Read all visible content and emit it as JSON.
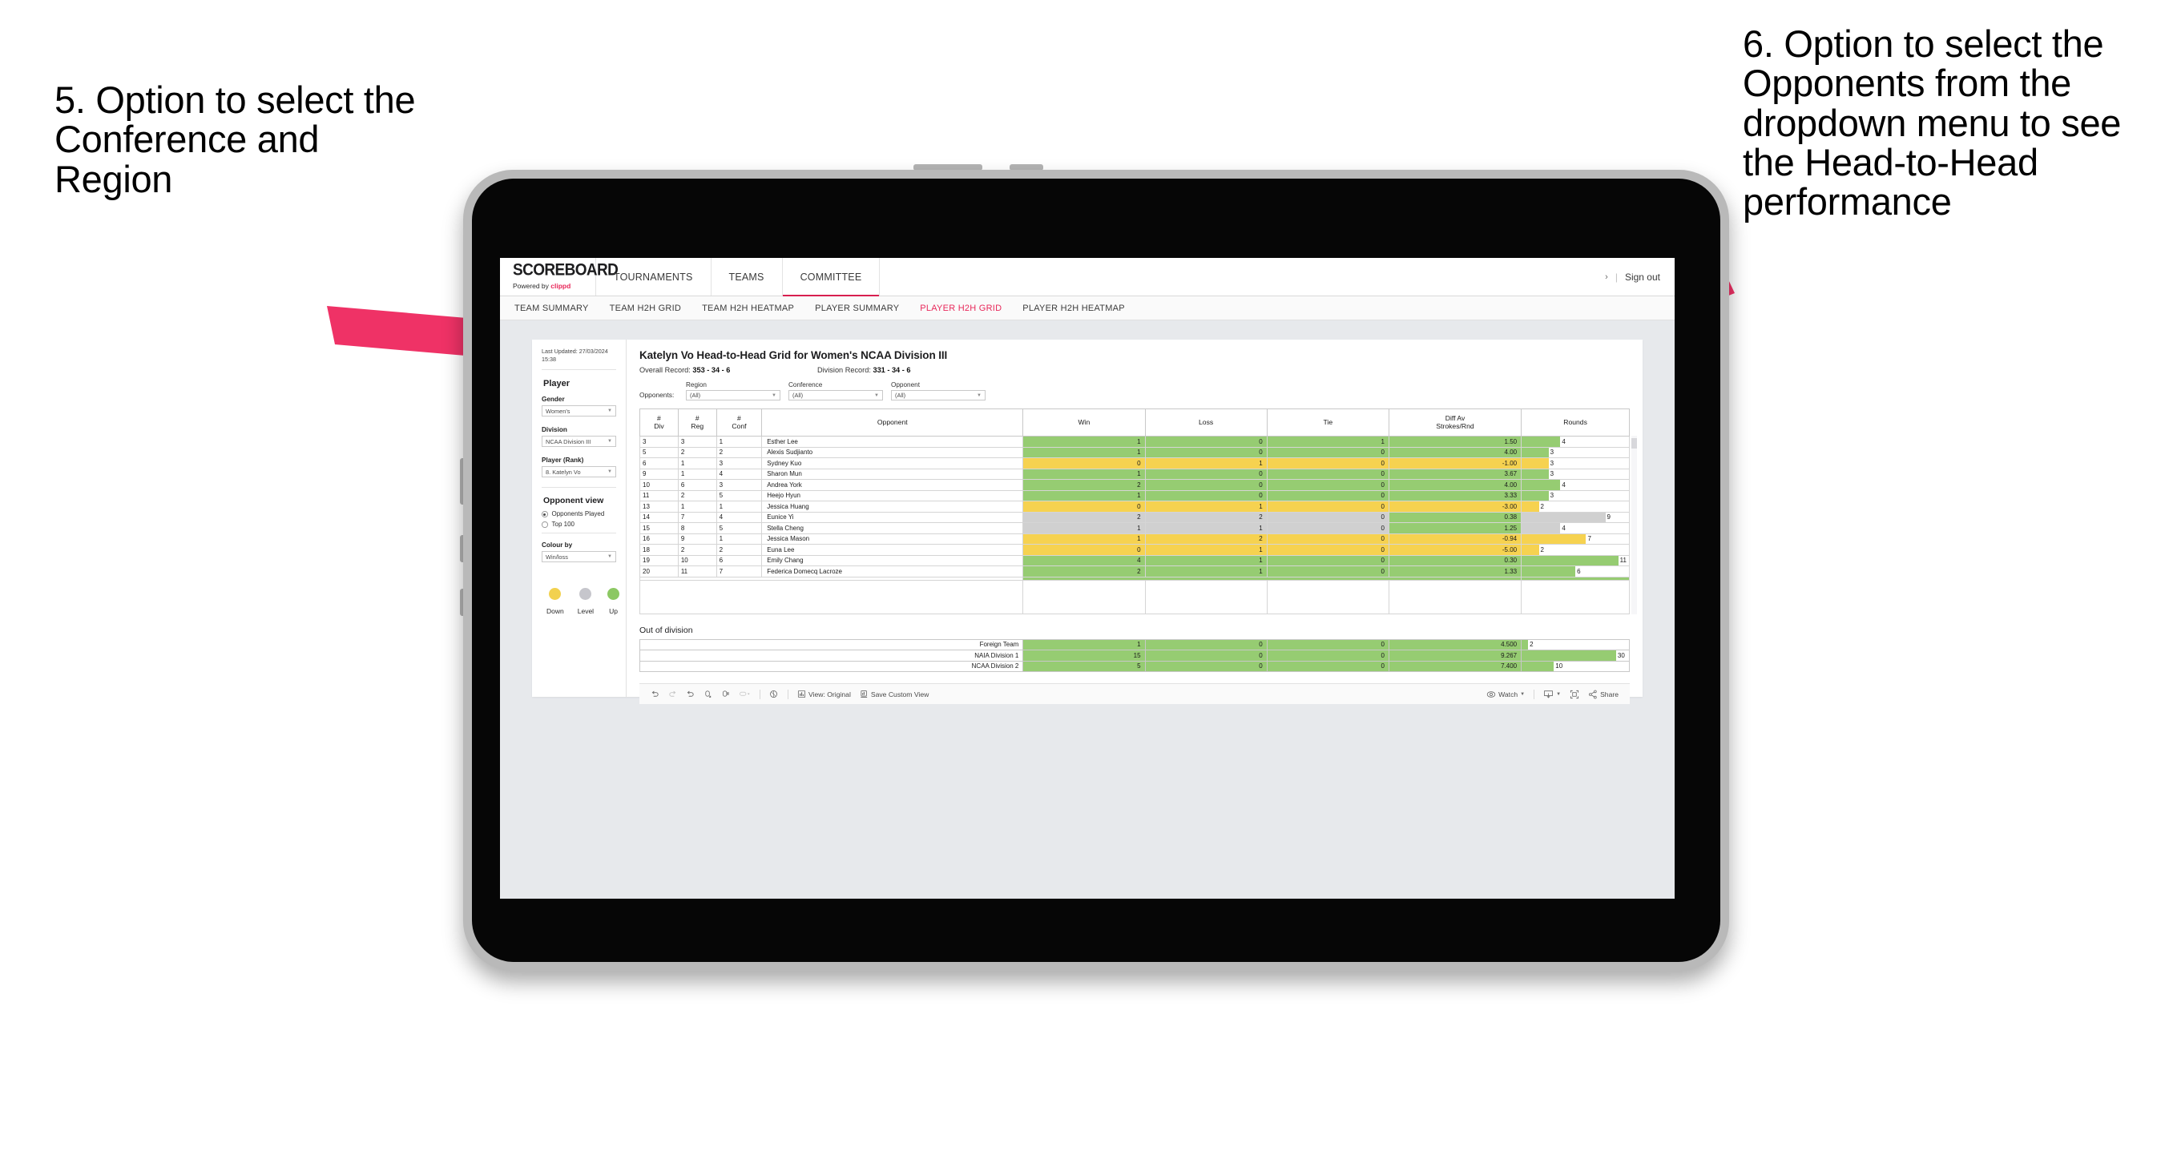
{
  "annotations": {
    "left": "5. Option to select the Conference and Region",
    "right": "6. Option to select the Opponents from the dropdown menu to see the Head-to-Head performance"
  },
  "app": {
    "brand": {
      "title": "SCOREBOARD",
      "powered_prefix": "Powered by ",
      "powered_name": "clippd"
    },
    "topnav": [
      "TOURNAMENTS",
      "TEAMS",
      "COMMITTEE"
    ],
    "topnav_active": "COMMITTEE",
    "signout": "Sign out",
    "subnav": [
      "TEAM SUMMARY",
      "TEAM H2H GRID",
      "TEAM H2H HEATMAP",
      "PLAYER SUMMARY",
      "PLAYER H2H GRID",
      "PLAYER H2H HEATMAP"
    ],
    "subnav_active": "PLAYER H2H GRID"
  },
  "sidebar": {
    "last_updated": "Last Updated: 27/03/2024 15:38",
    "player_heading": "Player",
    "fields": [
      {
        "label": "Gender",
        "value": "Women's"
      },
      {
        "label": "Division",
        "value": "NCAA Division III"
      },
      {
        "label": "Player (Rank)",
        "value": "8. Katelyn Vo"
      }
    ],
    "opponent_view_heading": "Opponent view",
    "opponent_view_options": [
      {
        "label": "Opponents Played",
        "selected": true
      },
      {
        "label": "Top 100",
        "selected": false
      }
    ],
    "colour_by": {
      "label": "Colour by",
      "value": "Win/loss"
    },
    "legend": [
      {
        "label": "Down",
        "color": "#f2d14e"
      },
      {
        "label": "Level",
        "color": "#c6c6cc"
      },
      {
        "label": "Up",
        "color": "#8cc863"
      }
    ]
  },
  "main": {
    "title": "Katelyn Vo Head-to-Head Grid for Women's NCAA Division III",
    "overall_record_label": "Overall Record: ",
    "overall_record_value": "353 - 34 - 6",
    "division_record_label": "Division Record: ",
    "division_record_value": "331 - 34 - 6",
    "opponents_label": "Opponents:",
    "filters": [
      {
        "label": "Region",
        "value": "(All)"
      },
      {
        "label": "Conference",
        "value": "(All)"
      },
      {
        "label": "Opponent",
        "value": "(All)"
      }
    ],
    "table": {
      "headers": [
        "# Div",
        "# Reg",
        "# Conf",
        "Opponent",
        "Win",
        "Loss",
        "Tie",
        "Diff Av Strokes/Rnd",
        "Rounds"
      ],
      "header_lines": [
        [
          "#",
          "Div"
        ],
        [
          "#",
          "Reg"
        ],
        [
          "#",
          "Conf"
        ],
        [
          "Opponent"
        ],
        [
          "Win"
        ],
        [
          "Loss"
        ],
        [
          "Tie"
        ],
        [
          "Diff Av",
          "Strokes/Rnd"
        ],
        [
          "Rounds"
        ]
      ],
      "rows": [
        {
          "div": "3",
          "reg": "3",
          "conf": "1",
          "opponent": "Esther Lee",
          "win": "1",
          "loss": "0",
          "tie": "1",
          "diff": "1.50",
          "rounds": "4",
          "color": "g",
          "bar": 36
        },
        {
          "div": "5",
          "reg": "2",
          "conf": "2",
          "opponent": "Alexis Sudjianto",
          "win": "1",
          "loss": "0",
          "tie": "0",
          "diff": "4.00",
          "rounds": "3",
          "color": "g",
          "bar": 25
        },
        {
          "div": "6",
          "reg": "1",
          "conf": "3",
          "opponent": "Sydney Kuo",
          "win": "0",
          "loss": "1",
          "tie": "0",
          "diff": "-1.00",
          "rounds": "3",
          "color": "y",
          "bar": 25
        },
        {
          "div": "9",
          "reg": "1",
          "conf": "4",
          "opponent": "Sharon Mun",
          "win": "1",
          "loss": "0",
          "tie": "0",
          "diff": "3.67",
          "rounds": "3",
          "color": "g",
          "bar": 25
        },
        {
          "div": "10",
          "reg": "6",
          "conf": "3",
          "opponent": "Andrea York",
          "win": "2",
          "loss": "0",
          "tie": "0",
          "diff": "4.00",
          "rounds": "4",
          "color": "g",
          "bar": 36
        },
        {
          "div": "11",
          "reg": "2",
          "conf": "5",
          "opponent": "Heejo Hyun",
          "win": "1",
          "loss": "0",
          "tie": "0",
          "diff": "3.33",
          "rounds": "3",
          "color": "g",
          "bar": 25
        },
        {
          "div": "13",
          "reg": "1",
          "conf": "1",
          "opponent": "Jessica Huang",
          "win": "0",
          "loss": "1",
          "tie": "0",
          "diff": "-3.00",
          "rounds": "2",
          "color": "y",
          "bar": 16
        },
        {
          "div": "14",
          "reg": "7",
          "conf": "4",
          "opponent": "Eunice Yi",
          "win": "2",
          "loss": "2",
          "tie": "0",
          "diff": "0.38",
          "rounds": "9",
          "color": "gr",
          "bar": 78,
          "diff_color": "g"
        },
        {
          "div": "15",
          "reg": "8",
          "conf": "5",
          "opponent": "Stella Cheng",
          "win": "1",
          "loss": "1",
          "tie": "0",
          "diff": "1.25",
          "rounds": "4",
          "color": "gr",
          "bar": 36,
          "diff_color": "g"
        },
        {
          "div": "16",
          "reg": "9",
          "conf": "1",
          "opponent": "Jessica Mason",
          "win": "1",
          "loss": "2",
          "tie": "0",
          "diff": "-0.94",
          "rounds": "7",
          "color": "y",
          "bar": 60
        },
        {
          "div": "18",
          "reg": "2",
          "conf": "2",
          "opponent": "Euna Lee",
          "win": "0",
          "loss": "1",
          "tie": "0",
          "diff": "-5.00",
          "rounds": "2",
          "color": "y",
          "bar": 16
        },
        {
          "div": "19",
          "reg": "10",
          "conf": "6",
          "opponent": "Emily Chang",
          "win": "4",
          "loss": "1",
          "tie": "0",
          "diff": "0.30",
          "rounds": "11",
          "color": "g",
          "bar": 90
        },
        {
          "div": "20",
          "reg": "11",
          "conf": "7",
          "opponent": "Federica Domecq Lacroze",
          "win": "2",
          "loss": "1",
          "tie": "0",
          "diff": "1.33",
          "rounds": "6",
          "color": "g",
          "bar": 50
        }
      ]
    },
    "out_of_division_title": "Out of division",
    "out_of_division": [
      {
        "name": "Foreign Team",
        "win": "1",
        "loss": "0",
        "tie": "0",
        "diff": "4.500",
        "rounds": "2",
        "bar": 6
      },
      {
        "name": "NAIA Division 1",
        "win": "15",
        "loss": "0",
        "tie": "0",
        "diff": "9.267",
        "rounds": "30",
        "bar": 88
      },
      {
        "name": "NCAA Division 2",
        "win": "5",
        "loss": "0",
        "tie": "0",
        "diff": "7.400",
        "rounds": "10",
        "bar": 30
      }
    ]
  },
  "toolbar": {
    "view_label": "View: Original",
    "save_label": "Save Custom View",
    "watch_label": "Watch",
    "share_label": "Share"
  }
}
